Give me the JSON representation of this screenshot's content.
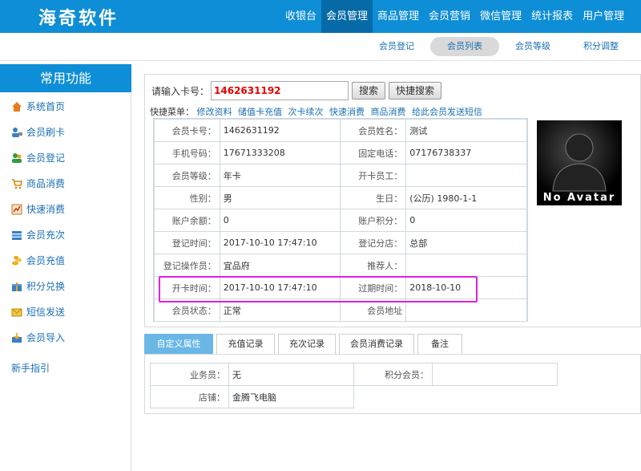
{
  "brand": "海奇软件",
  "nav": [
    "收银台",
    "会员管理",
    "商品管理",
    "会员营销",
    "微信管理",
    "统计报表",
    "用户管理"
  ],
  "nav_active": "会员管理",
  "subnav": [
    "会员登记",
    "会员列表",
    "会员等级",
    "积分调整"
  ],
  "subnav_active": "会员列表",
  "sidebar": {
    "title": "常用功能",
    "items": [
      {
        "label": "系统首页",
        "icon": "home-icon"
      },
      {
        "label": "会员刷卡",
        "icon": "user-card-icon"
      },
      {
        "label": "会员登记",
        "icon": "users-icon"
      },
      {
        "label": "商品消费",
        "icon": "cart-icon"
      },
      {
        "label": "快速消费",
        "icon": "chart-icon"
      },
      {
        "label": "会员充次",
        "icon": "stack-icon"
      },
      {
        "label": "会员充值",
        "icon": "coins-icon"
      },
      {
        "label": "积分兑换",
        "icon": "gift-icon"
      },
      {
        "label": "短信发送",
        "icon": "mail-icon"
      },
      {
        "label": "会员导入",
        "icon": "import-icon"
      }
    ],
    "help": "新手指引"
  },
  "search": {
    "label": "请输入卡号：",
    "value": "1462631192",
    "search_btn": "搜索",
    "quick_search_btn": "快捷搜索"
  },
  "quick_menu": {
    "label": "快捷菜单：",
    "links": [
      "修改资料",
      "储值卡充值",
      "次卡续次",
      "快速消费",
      "商品消费",
      "给此会员发送短信"
    ]
  },
  "member": {
    "rows": [
      [
        "会员卡号：",
        "1462631192",
        "会员姓名：",
        "测试"
      ],
      [
        "手机号码：",
        "17671333208",
        "固定电话：",
        "07176738337"
      ],
      [
        "会员等级：",
        "年卡",
        "开卡员工：",
        ""
      ],
      [
        "性别：",
        "男",
        "生日：",
        "(公历) 1980-1-1"
      ],
      [
        "账户余额：",
        "0",
        "账户积分：",
        "0"
      ],
      [
        "登记时间：",
        "2017-10-10 17:47:10",
        "登记分店：",
        "总部"
      ],
      [
        "登记操作员：",
        "宜品府",
        "推荐人：",
        ""
      ],
      [
        "开卡时间：",
        "2017-10-10 17:47:10",
        "过期时间：",
        "2018-10-10"
      ],
      [
        "会员状态：",
        "正常",
        "会员地址",
        ""
      ]
    ]
  },
  "avatar_text": "No Avatar",
  "tabs": [
    "自定义属性",
    "充值记录",
    "充次记录",
    "会员消费记录",
    "备注"
  ],
  "tab_active": "自定义属性",
  "custom_attrs": {
    "rows": [
      [
        "业务员：",
        "无",
        "积分会员：",
        ""
      ],
      [
        "店铺：",
        "金腾飞电脑",
        "",
        ""
      ]
    ]
  },
  "colors": {
    "brand_blue": "#0d8ed6",
    "nav_active": "#066aa6",
    "highlight": "#e020e0",
    "card_red": "#e60000",
    "tab_active": "#6ab7e6"
  }
}
